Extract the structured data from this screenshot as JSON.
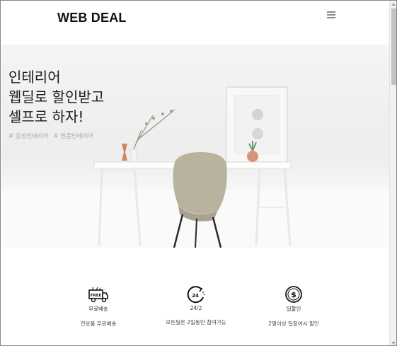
{
  "header": {
    "logo": "WEB DEAL",
    "menu_icon": "hamburger-menu-icon"
  },
  "hero": {
    "title_lines": [
      "인테리어",
      "웹딜로 할인받고",
      "셀프로 하자!"
    ],
    "tags": [
      "# 감성인테리어",
      "# 원룸인테리어"
    ]
  },
  "features": [
    {
      "icon": "free-delivery-truck-icon",
      "label": "무료배송",
      "description": "전상품 무료배송"
    },
    {
      "icon": "24-hours-clock-icon",
      "label": "24/2",
      "description": "모든딜은 2일동안 참여가능"
    },
    {
      "icon": "dollar-coin-icon",
      "label": "딜할인",
      "description": "2명이상 딜참여시 할인"
    }
  ],
  "colors": {
    "text": "#1a1a1a",
    "tag": "#a8a8a8",
    "hero_bg": "#f0f0f0"
  }
}
